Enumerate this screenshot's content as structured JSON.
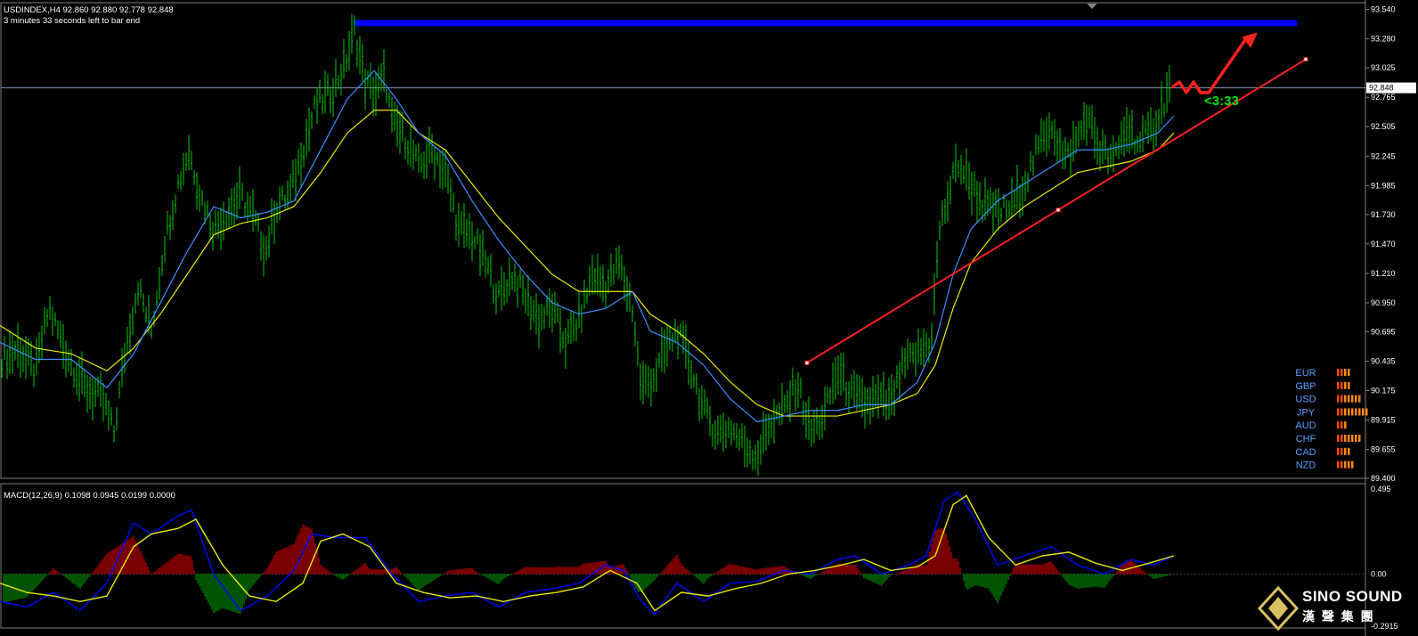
{
  "header": {
    "symbol_line": "USDINDEX,H4  92.860 92.880 92.778 92.848",
    "timer_line": "3 minutes 33 seconds left to bar end"
  },
  "macd": {
    "label": "MACD(12,26,9) 0.1098 0.0945 0.0199 0.0000"
  },
  "countdown": "<3:33",
  "brand": {
    "name": "SINO SOUND",
    "subtitle": "漢 聲 集 團"
  },
  "colors": {
    "background": "#000000",
    "bars": "#00c800",
    "fast_ma": "#3a8fff",
    "slow_ma": "#e8e800",
    "trendline": "#ff2020",
    "resistance": "#0000ff",
    "macd_line": "#0000ff",
    "signal_line": "#e8e800",
    "hist_pos": "#c80000",
    "hist_neg": "#008c00"
  },
  "chart_data": {
    "type": "line",
    "price_axis": [
      "93.540",
      "93.280",
      "93.025",
      "92.765",
      "92.505",
      "92.245",
      "91.985",
      "91.730",
      "91.470",
      "91.210",
      "90.950",
      "90.695",
      "90.435",
      "90.175",
      "89.915",
      "89.655",
      "89.400"
    ],
    "current_price": "92.848",
    "ylim": [
      89.4,
      93.6
    ],
    "price_path": [
      [
        0,
        90.45
      ],
      [
        20,
        90.55
      ],
      [
        40,
        90.35
      ],
      [
        55,
        90.9
      ],
      [
        75,
        90.5
      ],
      [
        95,
        90.2
      ],
      [
        115,
        90.1
      ],
      [
        128,
        89.8
      ],
      [
        140,
        90.5
      ],
      [
        155,
        91.1
      ],
      [
        170,
        90.7
      ],
      [
        185,
        91.5
      ],
      [
        200,
        92.0
      ],
      [
        212,
        92.3
      ],
      [
        225,
        91.9
      ],
      [
        240,
        91.6
      ],
      [
        255,
        91.75
      ],
      [
        270,
        91.9
      ],
      [
        285,
        91.7
      ],
      [
        298,
        91.4
      ],
      [
        310,
        91.8
      ],
      [
        325,
        91.9
      ],
      [
        340,
        92.3
      ],
      [
        355,
        92.7
      ],
      [
        370,
        92.8
      ],
      [
        385,
        93.0
      ],
      [
        398,
        93.35
      ],
      [
        410,
        92.9
      ],
      [
        422,
        92.8
      ],
      [
        432,
        92.95
      ],
      [
        440,
        92.55
      ],
      [
        455,
        92.4
      ],
      [
        470,
        92.15
      ],
      [
        485,
        92.3
      ],
      [
        500,
        92.1
      ],
      [
        515,
        91.6
      ],
      [
        530,
        91.55
      ],
      [
        545,
        91.3
      ],
      [
        560,
        91.0
      ],
      [
        575,
        91.2
      ],
      [
        590,
        91.0
      ],
      [
        605,
        90.8
      ],
      [
        620,
        90.9
      ],
      [
        635,
        90.6
      ],
      [
        650,
        90.8
      ],
      [
        665,
        91.2
      ],
      [
        680,
        91.1
      ],
      [
        695,
        91.3
      ],
      [
        710,
        90.9
      ],
      [
        720,
        90.2
      ],
      [
        735,
        90.3
      ],
      [
        745,
        90.5
      ],
      [
        760,
        90.7
      ],
      [
        775,
        90.4
      ],
      [
        790,
        90.0
      ],
      [
        805,
        89.8
      ],
      [
        820,
        89.85
      ],
      [
        835,
        89.7
      ],
      [
        850,
        89.6
      ],
      [
        865,
        89.9
      ],
      [
        880,
        90.0
      ],
      [
        895,
        90.25
      ],
      [
        910,
        89.8
      ],
      [
        925,
        89.95
      ],
      [
        940,
        90.35
      ],
      [
        955,
        90.15
      ],
      [
        970,
        90.05
      ],
      [
        985,
        90.1
      ],
      [
        1000,
        90.05
      ],
      [
        1015,
        90.4
      ],
      [
        1030,
        90.5
      ],
      [
        1045,
        90.6
      ],
      [
        1055,
        91.6
      ],
      [
        1065,
        91.9
      ],
      [
        1075,
        92.2
      ],
      [
        1090,
        92.0
      ],
      [
        1105,
        91.8
      ],
      [
        1120,
        91.75
      ],
      [
        1135,
        91.8
      ],
      [
        1150,
        92.0
      ],
      [
        1165,
        92.3
      ],
      [
        1180,
        92.55
      ],
      [
        1195,
        92.2
      ],
      [
        1210,
        92.4
      ],
      [
        1220,
        92.6
      ],
      [
        1235,
        92.3
      ],
      [
        1250,
        92.2
      ],
      [
        1265,
        92.5
      ],
      [
        1280,
        92.35
      ],
      [
        1295,
        92.5
      ],
      [
        1308,
        92.75
      ],
      [
        1315,
        92.9
      ]
    ],
    "fast_ma": [
      [
        0,
        90.6
      ],
      [
        40,
        90.45
      ],
      [
        80,
        90.45
      ],
      [
        120,
        90.2
      ],
      [
        150,
        90.5
      ],
      [
        180,
        90.95
      ],
      [
        210,
        91.4
      ],
      [
        240,
        91.8
      ],
      [
        270,
        91.7
      ],
      [
        300,
        91.75
      ],
      [
        330,
        91.85
      ],
      [
        360,
        92.3
      ],
      [
        390,
        92.75
      ],
      [
        420,
        93.0
      ],
      [
        445,
        92.75
      ],
      [
        470,
        92.45
      ],
      [
        500,
        92.25
      ],
      [
        530,
        91.85
      ],
      [
        560,
        91.5
      ],
      [
        590,
        91.2
      ],
      [
        620,
        90.95
      ],
      [
        650,
        90.85
      ],
      [
        680,
        90.9
      ],
      [
        710,
        91.05
      ],
      [
        730,
        90.7
      ],
      [
        760,
        90.6
      ],
      [
        790,
        90.4
      ],
      [
        820,
        90.1
      ],
      [
        850,
        89.9
      ],
      [
        880,
        89.95
      ],
      [
        910,
        90.0
      ],
      [
        940,
        90.0
      ],
      [
        970,
        90.05
      ],
      [
        1000,
        90.05
      ],
      [
        1030,
        90.25
      ],
      [
        1050,
        90.6
      ],
      [
        1070,
        91.2
      ],
      [
        1090,
        91.6
      ],
      [
        1120,
        91.85
      ],
      [
        1150,
        92.0
      ],
      [
        1180,
        92.15
      ],
      [
        1210,
        92.3
      ],
      [
        1240,
        92.3
      ],
      [
        1270,
        92.35
      ],
      [
        1300,
        92.45
      ],
      [
        1318,
        92.6
      ]
    ],
    "slow_ma": [
      [
        0,
        90.75
      ],
      [
        40,
        90.55
      ],
      [
        80,
        90.5
      ],
      [
        120,
        90.35
      ],
      [
        150,
        90.55
      ],
      [
        180,
        90.85
      ],
      [
        210,
        91.2
      ],
      [
        240,
        91.55
      ],
      [
        270,
        91.65
      ],
      [
        300,
        91.7
      ],
      [
        330,
        91.8
      ],
      [
        360,
        92.1
      ],
      [
        390,
        92.45
      ],
      [
        420,
        92.65
      ],
      [
        445,
        92.65
      ],
      [
        470,
        92.45
      ],
      [
        500,
        92.3
      ],
      [
        530,
        92.0
      ],
      [
        560,
        91.7
      ],
      [
        590,
        91.45
      ],
      [
        620,
        91.2
      ],
      [
        650,
        91.05
      ],
      [
        680,
        91.05
      ],
      [
        710,
        91.05
      ],
      [
        730,
        90.85
      ],
      [
        760,
        90.7
      ],
      [
        790,
        90.5
      ],
      [
        820,
        90.25
      ],
      [
        850,
        90.05
      ],
      [
        880,
        89.95
      ],
      [
        910,
        89.95
      ],
      [
        940,
        89.95
      ],
      [
        970,
        90.0
      ],
      [
        1000,
        90.05
      ],
      [
        1030,
        90.15
      ],
      [
        1050,
        90.4
      ],
      [
        1070,
        90.9
      ],
      [
        1090,
        91.3
      ],
      [
        1120,
        91.6
      ],
      [
        1150,
        91.8
      ],
      [
        1180,
        91.95
      ],
      [
        1210,
        92.1
      ],
      [
        1240,
        92.15
      ],
      [
        1270,
        92.2
      ],
      [
        1300,
        92.3
      ],
      [
        1318,
        92.45
      ]
    ],
    "trendline": [
      [
        906,
        90.42
      ],
      [
        1466,
        93.1
      ]
    ],
    "resistance": [
      [
        398,
        93.42
      ],
      [
        1456,
        93.42
      ]
    ],
    "macd_line": [
      [
        0,
        -0.15
      ],
      [
        30,
        -0.18
      ],
      [
        60,
        -0.1
      ],
      [
        90,
        -0.2
      ],
      [
        120,
        -0.05
      ],
      [
        150,
        0.28
      ],
      [
        170,
        0.22
      ],
      [
        200,
        0.32
      ],
      [
        215,
        0.35
      ],
      [
        240,
        0.0
      ],
      [
        270,
        -0.2
      ],
      [
        300,
        -0.12
      ],
      [
        330,
        0.02
      ],
      [
        350,
        0.22
      ],
      [
        375,
        0.2
      ],
      [
        410,
        0.2
      ],
      [
        440,
        0.0
      ],
      [
        470,
        -0.15
      ],
      [
        500,
        -0.12
      ],
      [
        530,
        -0.1
      ],
      [
        560,
        -0.18
      ],
      [
        590,
        -0.1
      ],
      [
        620,
        -0.08
      ],
      [
        650,
        -0.05
      ],
      [
        680,
        0.05
      ],
      [
        700,
        0.02
      ],
      [
        720,
        -0.15
      ],
      [
        735,
        -0.22
      ],
      [
        760,
        -0.05
      ],
      [
        790,
        -0.15
      ],
      [
        820,
        -0.05
      ],
      [
        850,
        -0.04
      ],
      [
        880,
        0.02
      ],
      [
        910,
        0.0
      ],
      [
        940,
        0.08
      ],
      [
        960,
        0.1
      ],
      [
        990,
        0.0
      ],
      [
        1020,
        0.05
      ],
      [
        1040,
        0.1
      ],
      [
        1060,
        0.4
      ],
      [
        1075,
        0.45
      ],
      [
        1095,
        0.3
      ],
      [
        1120,
        0.05
      ],
      [
        1150,
        0.1
      ],
      [
        1180,
        0.15
      ],
      [
        1210,
        0.05
      ],
      [
        1240,
        0.0
      ],
      [
        1270,
        0.08
      ],
      [
        1295,
        0.05
      ],
      [
        1318,
        0.1
      ]
    ],
    "signal_line": [
      [
        0,
        -0.05
      ],
      [
        30,
        -0.1
      ],
      [
        60,
        -0.12
      ],
      [
        90,
        -0.15
      ],
      [
        120,
        -0.12
      ],
      [
        150,
        0.15
      ],
      [
        170,
        0.22
      ],
      [
        200,
        0.25
      ],
      [
        220,
        0.3
      ],
      [
        250,
        0.05
      ],
      [
        280,
        -0.12
      ],
      [
        310,
        -0.15
      ],
      [
        340,
        -0.05
      ],
      [
        360,
        0.18
      ],
      [
        385,
        0.22
      ],
      [
        415,
        0.15
      ],
      [
        445,
        -0.05
      ],
      [
        475,
        -0.1
      ],
      [
        505,
        -0.13
      ],
      [
        535,
        -0.12
      ],
      [
        565,
        -0.15
      ],
      [
        595,
        -0.12
      ],
      [
        625,
        -0.1
      ],
      [
        655,
        -0.07
      ],
      [
        685,
        0.02
      ],
      [
        715,
        -0.05
      ],
      [
        735,
        -0.2
      ],
      [
        765,
        -0.1
      ],
      [
        795,
        -0.12
      ],
      [
        825,
        -0.08
      ],
      [
        855,
        -0.05
      ],
      [
        885,
        0.0
      ],
      [
        915,
        0.02
      ],
      [
        945,
        0.05
      ],
      [
        970,
        0.08
      ],
      [
        1000,
        0.02
      ],
      [
        1030,
        0.04
      ],
      [
        1050,
        0.1
      ],
      [
        1070,
        0.38
      ],
      [
        1085,
        0.43
      ],
      [
        1110,
        0.2
      ],
      [
        1140,
        0.05
      ],
      [
        1170,
        0.1
      ],
      [
        1200,
        0.12
      ],
      [
        1230,
        0.06
      ],
      [
        1260,
        0.02
      ],
      [
        1290,
        0.06
      ],
      [
        1318,
        0.1
      ]
    ],
    "macd_ylim": [
      -0.295,
      0.495
    ],
    "macd_axis": [
      "0.495",
      "0.00",
      "-0.2915"
    ]
  },
  "strength": {
    "items": [
      {
        "name": "EUR",
        "value": 4
      },
      {
        "name": "GBP",
        "value": 4
      },
      {
        "name": "USD",
        "value": 7
      },
      {
        "name": "JPY",
        "value": 9
      },
      {
        "name": "AUD",
        "value": 3
      },
      {
        "name": "CHF",
        "value": 7
      },
      {
        "name": "CAD",
        "value": 4
      },
      {
        "name": "NZD",
        "value": 5
      }
    ],
    "max": 10
  }
}
